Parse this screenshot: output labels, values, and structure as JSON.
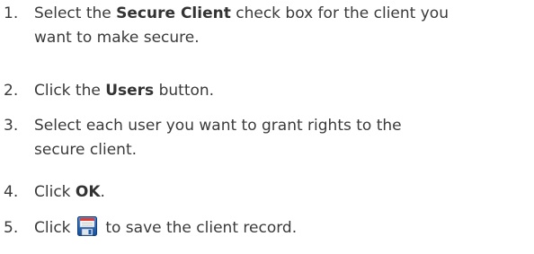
{
  "steps": [
    {
      "number": "1.",
      "before": "Select the ",
      "bold": "Secure Client",
      "after_line1": " check box for the client you",
      "line2": "want to make secure."
    },
    {
      "number": "2.",
      "before": "Click the ",
      "bold": "Users",
      "after": " button."
    },
    {
      "number": "3.",
      "line1": "Select each user you want to grant rights to the",
      "line2": "secure client."
    },
    {
      "number": "4.",
      "before": "Click ",
      "bold": "OK",
      "after": "."
    },
    {
      "number": "5.",
      "before": "Click",
      "icon": "save-icon",
      "after": "to save the client record."
    }
  ],
  "colors": {
    "text": "#3a3a3a",
    "save_icon_frame": "#1f5aa8",
    "save_icon_label": "#e23b2f"
  }
}
